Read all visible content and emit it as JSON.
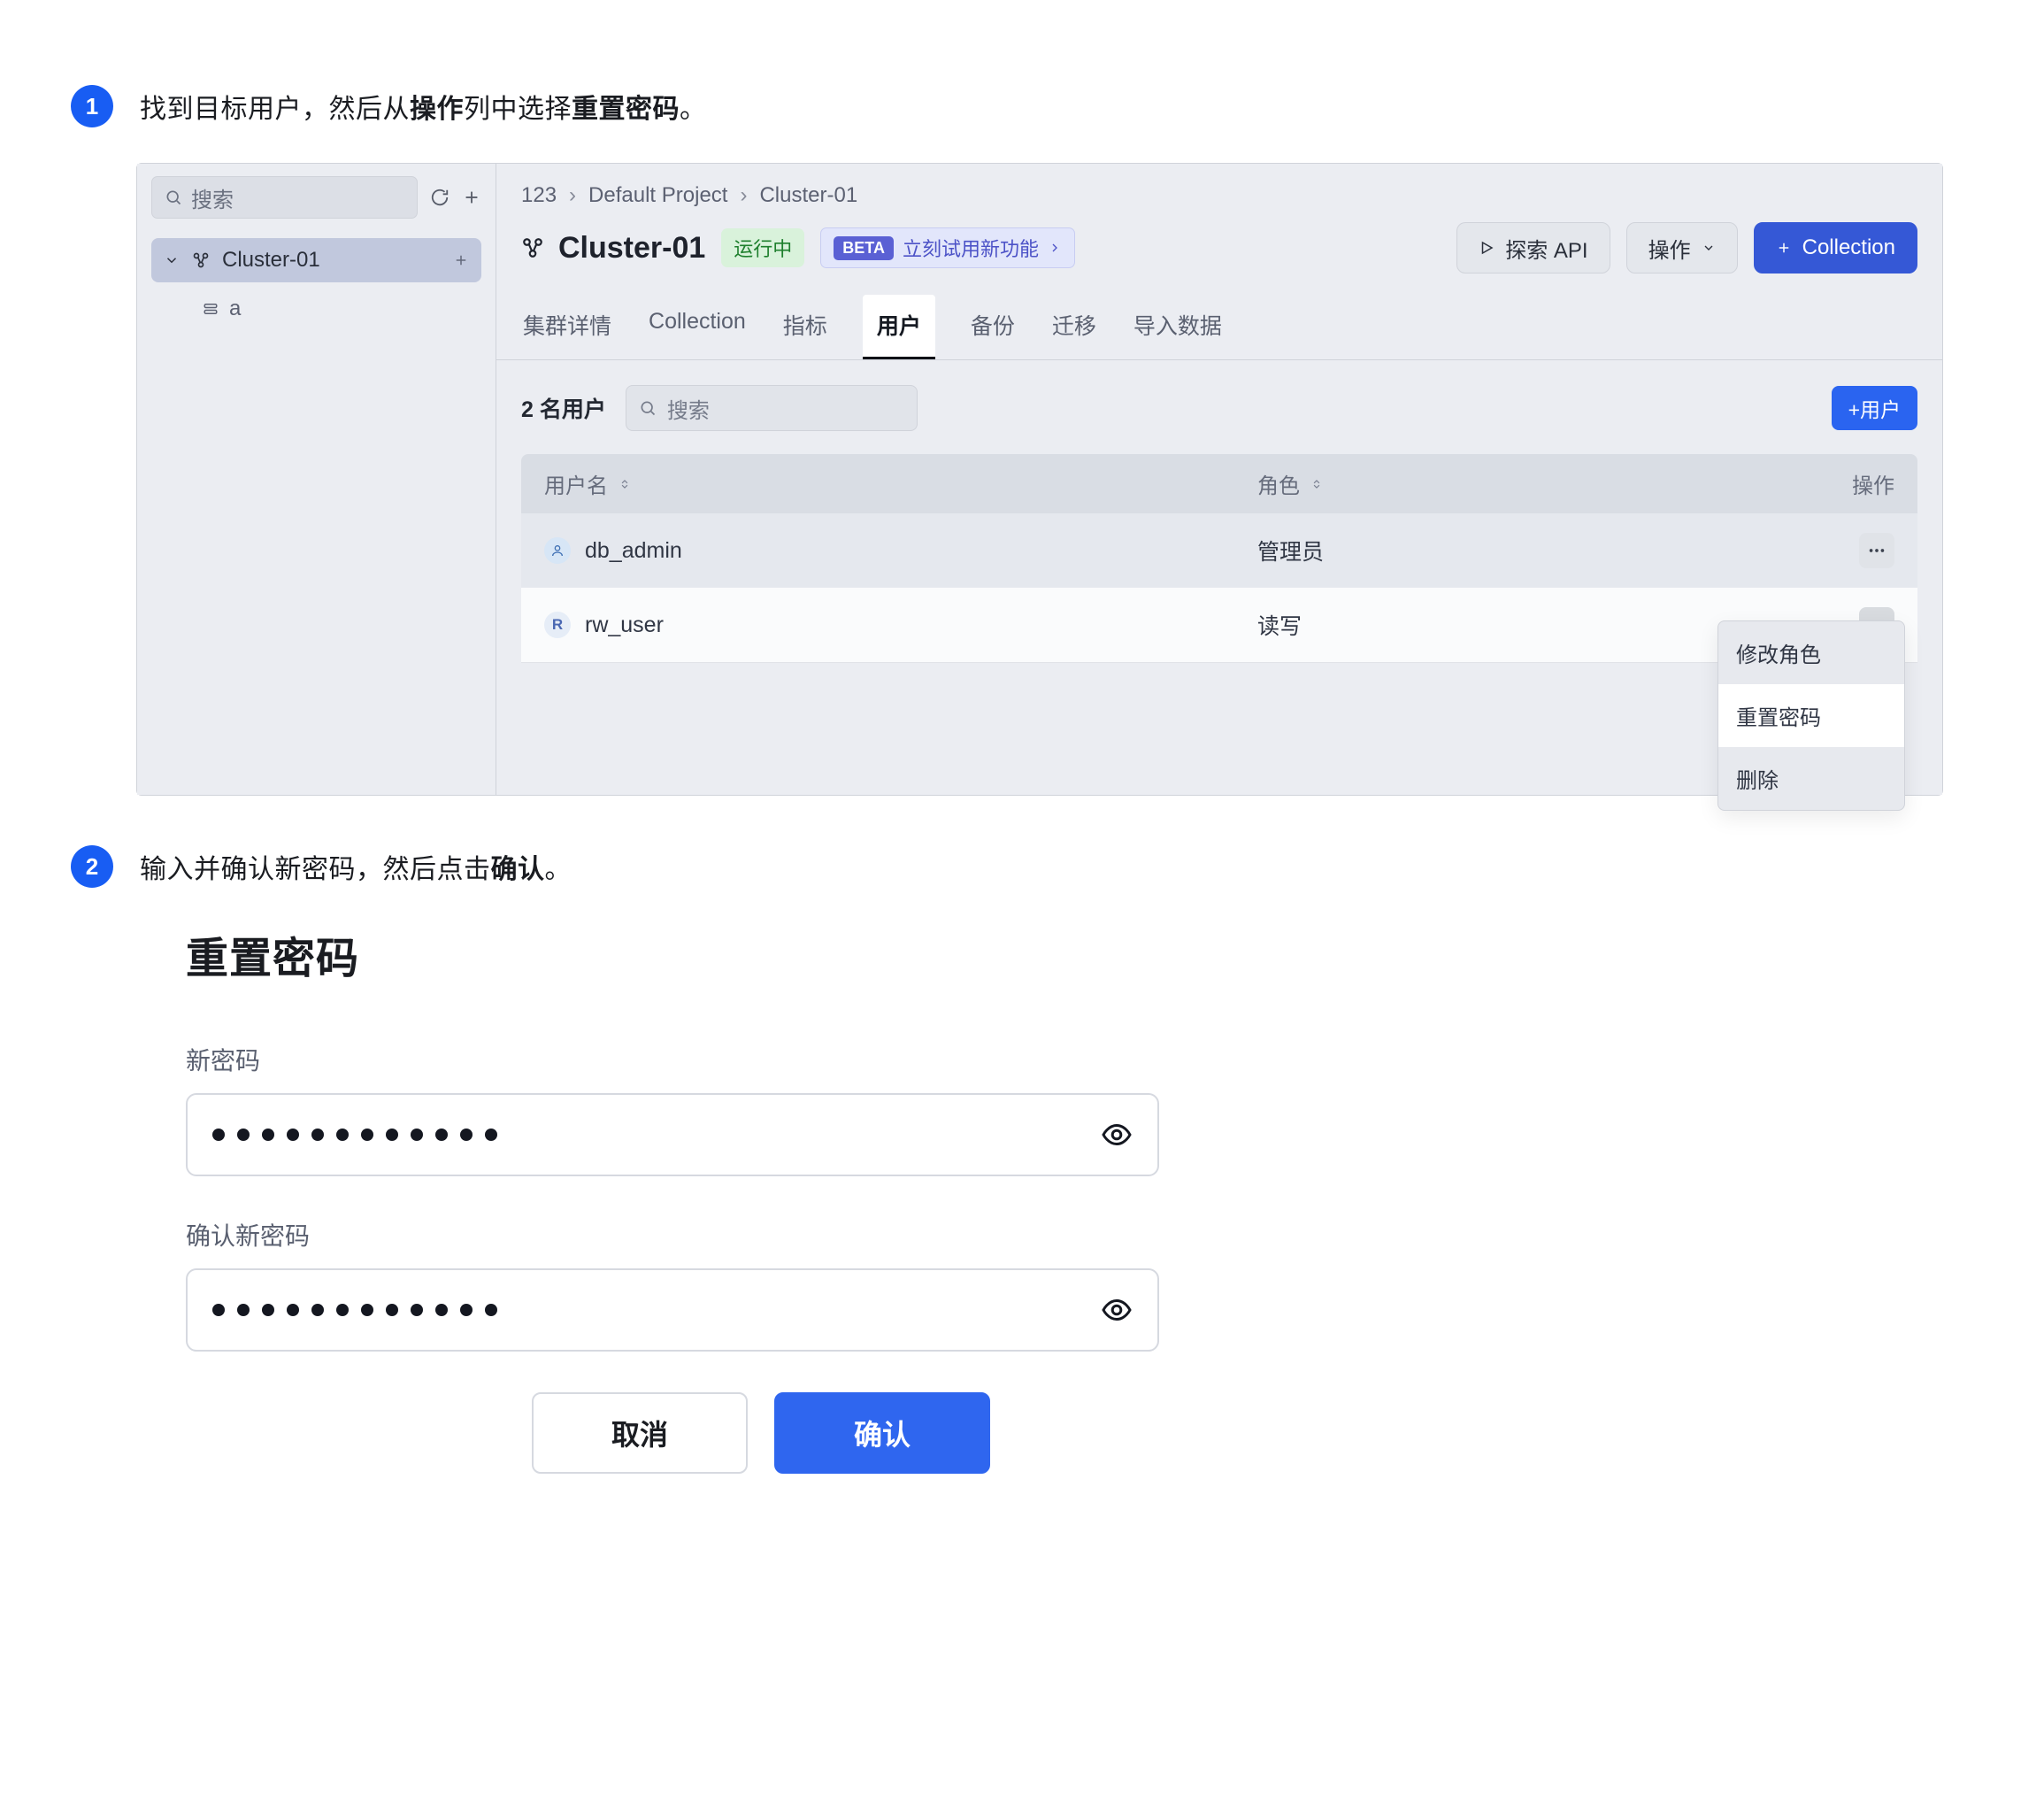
{
  "step1": {
    "badge": "1",
    "text_before": "找到目标用户，然后从",
    "text_bold1": "操作",
    "text_mid": "列中选择",
    "text_bold2": "重置密码",
    "text_after": "。"
  },
  "step2": {
    "badge": "2",
    "text_before": "输入并确认新密码，然后点击",
    "text_bold1": "确认",
    "text_after": "。"
  },
  "sidebar": {
    "search_placeholder": "搜索",
    "selected": "Cluster-01",
    "child": "a"
  },
  "breadcrumb": [
    "123",
    "Default Project",
    "Cluster-01"
  ],
  "header": {
    "title": "Cluster-01",
    "status": "运行中",
    "beta_tag": "BETA",
    "beta_text": "立刻试用新功能",
    "explore_api": "探索 API",
    "operate": "操作",
    "collection": "Collection"
  },
  "tabs": [
    "集群详情",
    "Collection",
    "指标",
    "用户",
    "备份",
    "迁移",
    "导入数据"
  ],
  "active_tab_index": 3,
  "users": {
    "count_label": "2 名用户",
    "search_placeholder": "搜索",
    "add_label": "+用户"
  },
  "table": {
    "cols": {
      "name": "用户名",
      "role": "角色",
      "action": "操作"
    },
    "rows": [
      {
        "avatar": "person",
        "avatar_class": "blue",
        "name": "db_admin",
        "role": "管理员",
        "menu_open": false
      },
      {
        "avatar": "R",
        "avatar_class": "r",
        "name": "rw_user",
        "role": "读写",
        "menu_open": true
      }
    ],
    "menu": [
      "修改角色",
      "重置密码",
      "删除"
    ],
    "menu_selected_index": 1
  },
  "form": {
    "title": "重置密码",
    "new_label": "新密码",
    "confirm_label": "确认新密码",
    "new_dots": 12,
    "confirm_dots": 12,
    "cancel": "取消",
    "ok": "确认"
  }
}
